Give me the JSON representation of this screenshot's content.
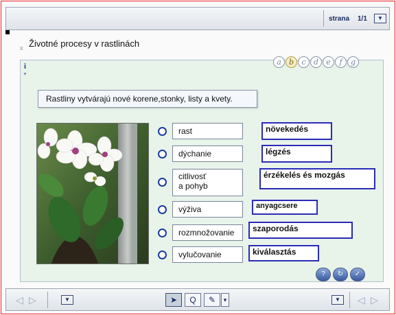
{
  "header": {
    "page_label": "strana",
    "page_number": "1/1",
    "dropdown_glyph": "▼"
  },
  "exercise": {
    "close_glyph": "x",
    "title": "Životné procesy v rastlinách",
    "info_glyph": "i",
    "info_arrow_glyph": "▼",
    "letters": [
      "a",
      "b",
      "c",
      "d",
      "e",
      "f",
      "g"
    ],
    "active_letter_index": 1,
    "statement": "Rastliny vytvárajú nové korene,stonky, listy a kvety.",
    "terms": [
      {
        "line1": "rast",
        "line2": ""
      },
      {
        "line1": "dýchanie",
        "line2": ""
      },
      {
        "line1": "citlivosť",
        "line2": "a pohyb"
      },
      {
        "line1": "výživa",
        "line2": ""
      },
      {
        "line1": "rozmnožovanie",
        "line2": ""
      },
      {
        "line1": "vylučovanie",
        "line2": ""
      }
    ],
    "answers": [
      "növekedés",
      "légzés",
      "érzékelés és mozgás",
      "anyagcsere",
      "szaporodás",
      "kiválasztás"
    ],
    "action_glyphs": [
      "?",
      "↻",
      "✓"
    ]
  },
  "toolbar": {
    "prev_glyph": "◁",
    "next_glyph": "▷",
    "dropdown_glyph": "▼",
    "pointer_glyph": "➤",
    "search_glyph": "Q",
    "pen_glyph": "✎",
    "pen_dropdown_glyph": "▾"
  },
  "colors": {
    "frame_border": "#e02020",
    "content_bg": "#e8f3ea",
    "answer_border": "#2a2ab8",
    "radio": "#1a3aa0"
  }
}
